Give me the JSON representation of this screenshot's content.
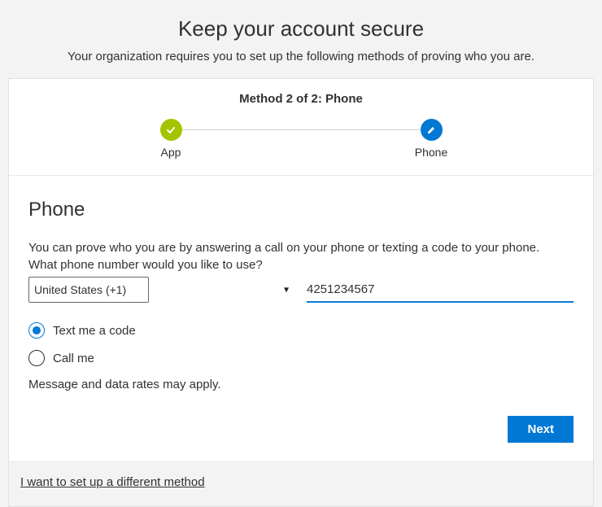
{
  "header": {
    "title": "Keep your account secure",
    "subtitle": "Your organization requires you to set up the following methods of proving who you are."
  },
  "wizard": {
    "method_label": "Method 2 of 2: Phone",
    "steps": [
      {
        "label": "App"
      },
      {
        "label": "Phone"
      }
    ]
  },
  "body": {
    "section_title": "Phone",
    "help_text": "You can prove who you are by answering a call on your phone or texting a code to your phone.",
    "prompt": "What phone number would you like to use?",
    "country_value": "United States (+1)",
    "phone_value": "4251234567",
    "radios": {
      "text_me": "Text me a code",
      "call_me": "Call me"
    },
    "rates": "Message and data rates may apply.",
    "next_label": "Next"
  },
  "footer": {
    "alt_link": "I want to set up a different method"
  }
}
